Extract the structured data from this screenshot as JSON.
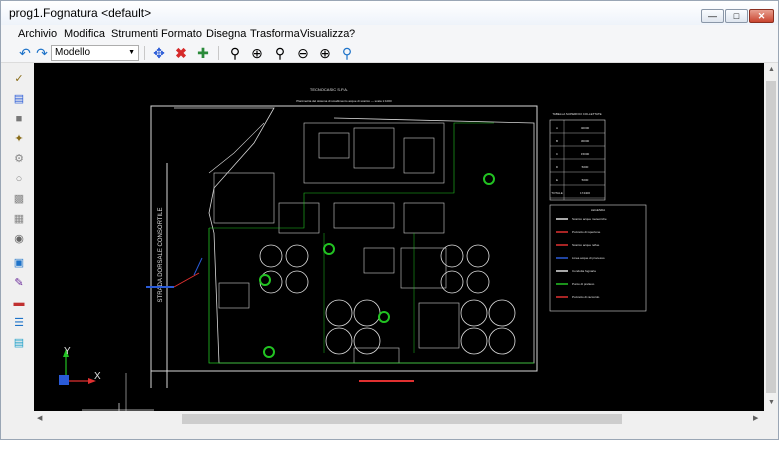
{
  "window": {
    "title": "prog1.Fognatura <default>"
  },
  "menu": [
    "Archivio",
    "Modifica",
    "Strumenti",
    "Formato",
    "Disegna",
    "Trasforma",
    "Visualizza",
    "?"
  ],
  "toolbar": {
    "view_select": "Modello",
    "icons": [
      "undo-icon",
      "redo-icon",
      "move-icon",
      "delete-icon",
      "copy-icon",
      "zoom-window-icon",
      "zoom-extents-icon",
      "zoom-previous-icon",
      "zoom-out-icon",
      "zoom-in-icon",
      "zoom-realtime-icon"
    ]
  },
  "drawing": {
    "company": "TECNOCASIC S.P.A.",
    "subtitle": "Planimetria del sistema di smaltimento acque di scarico — scala 1:1000",
    "road_label": "STRADA DORSALE CONSORTILE",
    "table_title": "TABELLA SUPERFICI COLLETTATE",
    "table_rows": [
      {
        "code": "A",
        "value": "40000"
      },
      {
        "code": "B",
        "value": "30000"
      },
      {
        "code": "C",
        "value": "15000"
      },
      {
        "code": "D",
        "value": "5000"
      },
      {
        "code": "E",
        "value": "5000"
      },
      {
        "code": "TOTALE",
        "value": "174400"
      }
    ],
    "legend_title": "LEGENDA",
    "legend_items": [
      "Scarico acque meteoriche",
      "Pozzetto di ispezione",
      "Scarico acque reflue",
      "Linea acque di processo",
      "Condotta fognaria",
      "Punto di prelievo",
      "Pozzetto di raccordo"
    ],
    "ucs": {
      "x": "X",
      "y": "Y"
    }
  },
  "colors": {
    "canvas": "#000000",
    "lines": "#d8d8d8",
    "green": "#22c322",
    "red": "#e03030",
    "blue": "#2a5bd7",
    "accent_blue": "#1e73c9"
  }
}
